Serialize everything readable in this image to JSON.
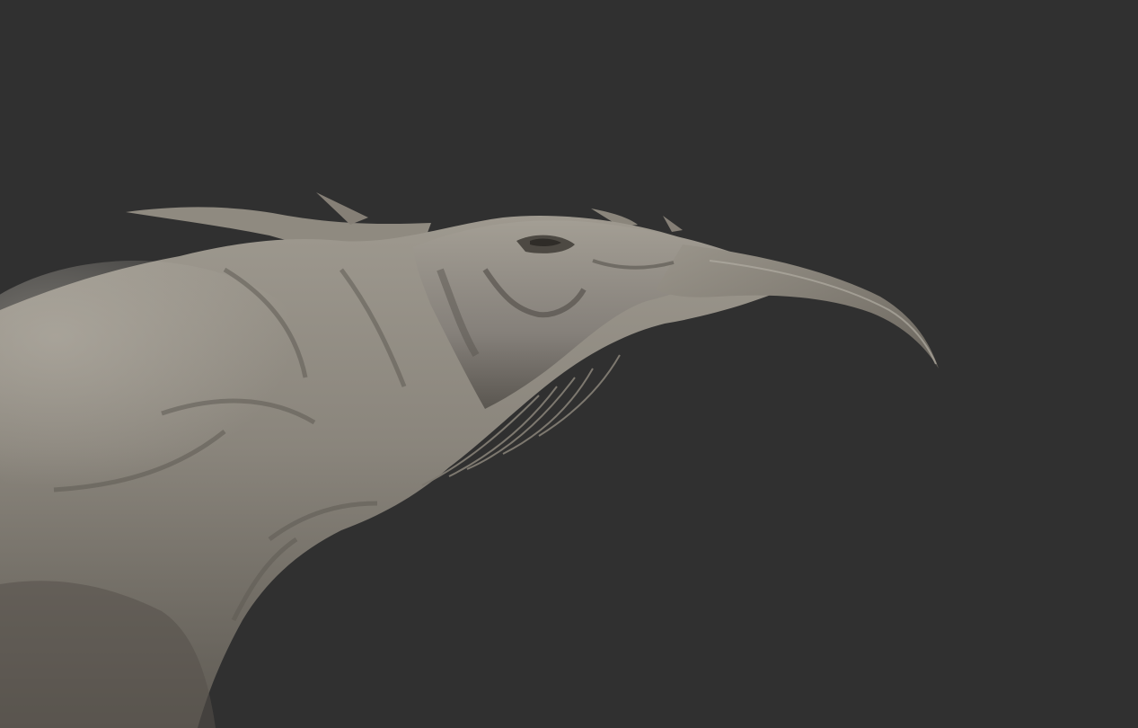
{
  "scene": {
    "background_color": "#303030",
    "subject": "creature-sculpt",
    "material_color": "#8c877e",
    "highlight_color": "#b4afa6",
    "shadow_color": "#4a4640"
  }
}
